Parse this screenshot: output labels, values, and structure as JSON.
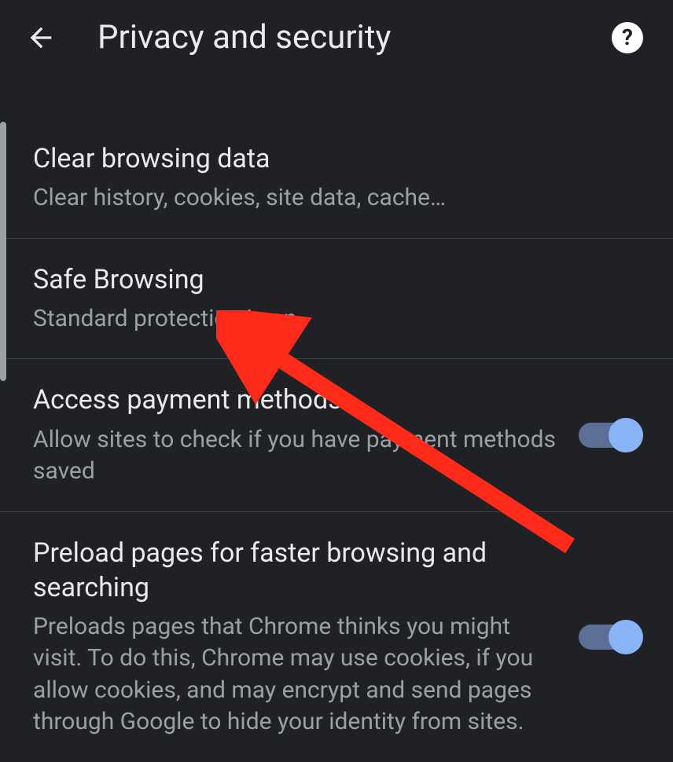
{
  "header": {
    "title": "Privacy and security"
  },
  "items": [
    {
      "title": "Clear browsing data",
      "subtitle": "Clear history, cookies, site data, cache…"
    },
    {
      "title": "Safe Browsing",
      "subtitle": "Standard protection is on"
    },
    {
      "title": "Access payment methods",
      "subtitle": "Allow sites to check if you have payment methods saved"
    },
    {
      "title": "Preload pages for faster browsing and searching",
      "subtitle": "Preloads pages that Chrome thinks you might visit. To do this, Chrome may use cookies, if you allow cookies, and may encrypt and send pages through Google to hide your identity from sites."
    }
  ]
}
